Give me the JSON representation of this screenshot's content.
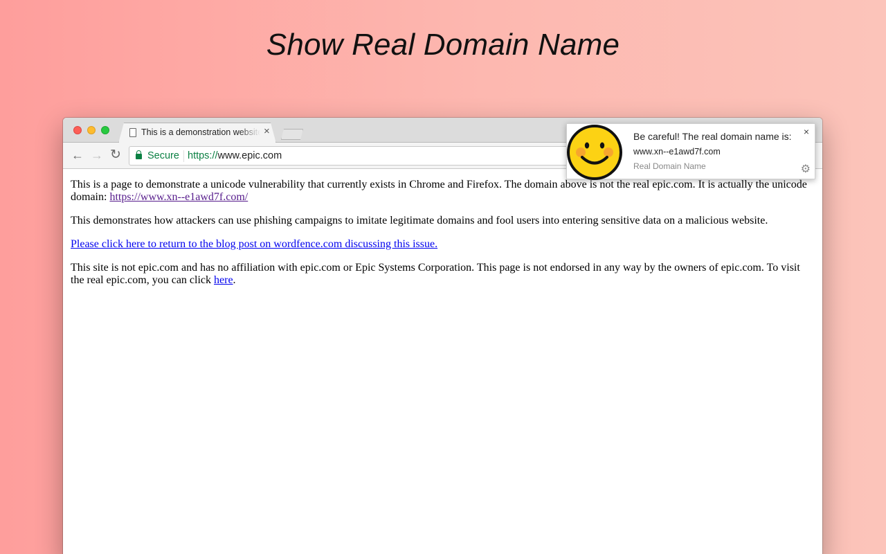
{
  "headline": "Show Real Domain Name",
  "browser": {
    "tab_title": "This is a demonstration website",
    "tab_close": "×",
    "nav": {
      "back": "←",
      "forward": "→",
      "reload": "↻"
    },
    "omnibox": {
      "security_label": "Secure",
      "url_scheme": "https://",
      "url_host": "www.epic.com"
    }
  },
  "page": {
    "para1_text": "This is a page to demonstrate a unicode vulnerability that currently exists in Chrome and Firefox. The domain above is not the real epic.com. It is actually the unicode domain: ",
    "para1_link": "https://www.xn--e1awd7f.com/",
    "para2_text": "This demonstrates how attackers can use phishing campaigns to imitate legitimate domains and fool users into entering sensitive data on a malicious website.",
    "blog_link": "Please click here to return to the blog post on wordfence.com discussing this issue.",
    "para4_text": "This site is not epic.com and has no affiliation with epic.com or Epic Systems Corporation. This page is not endorsed in any way by the owners of epic.com. To visit the real epic.com, you can click ",
    "para4_link": "here",
    "para4_end": "."
  },
  "notification": {
    "title": "Be careful! The real domain name is:",
    "domain": "www.xn--e1awd7f.com",
    "source": "Real Domain Name",
    "close": "×",
    "settings_icon": "gear-icon",
    "icon": "smiley-face-icon"
  },
  "colors": {
    "secure_green": "#0b8043",
    "link_blue": "#0000ee",
    "link_visited": "#551a8b",
    "smiley_yellow": "#fcd214",
    "cheek_orange": "#f7a62e"
  }
}
